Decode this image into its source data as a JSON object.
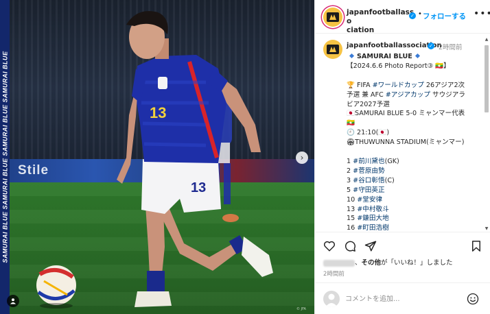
{
  "photo": {
    "side_banner_text": "SAMURAI BLUE SAMURAI BLUE SAMURAI BLUE SAMURAI BLUE",
    "ad_text": "Stile",
    "jersey_number": "13",
    "shorts_number": "13",
    "credit": "© JFA"
  },
  "header": {
    "username_line1": "japanfootballasso",
    "username_line2": "ciation",
    "follow_label": "フォローする",
    "separator": "•",
    "more_label": "•••"
  },
  "caption": {
    "username": "japanfootballassociation",
    "time": "2時間前",
    "lines": [
      {
        "type": "title",
        "text": "SAMURAI BLUE"
      },
      {
        "type": "plain",
        "text": "【2024.6.6 Photo Report③ 🇲🇲】"
      },
      {
        "type": "plain",
        "text": ""
      },
      {
        "type": "rich",
        "prefix": "🏆 FIFA ",
        "tag": "#ワールドカップ",
        "suffix": " 26アジア2次"
      },
      {
        "type": "rich",
        "prefix": "予選 兼 AFC ",
        "tag": "#アジアカップ",
        "suffix": " サウジアラ"
      },
      {
        "type": "plain",
        "text": "ビア2027予選"
      },
      {
        "type": "plain",
        "text": "🇯🇵SAMURAI BLUE 5-0 ミャンマー代表"
      },
      {
        "type": "plain",
        "text": "🇲🇲"
      },
      {
        "type": "plain",
        "text": "🕘 21:10(🇯🇵)"
      },
      {
        "type": "plain",
        "text": "🏟THUWUNNA STADIUM(ミャンマー)"
      },
      {
        "type": "plain",
        "text": ""
      },
      {
        "type": "rich",
        "prefix": "1 ",
        "tag": "#前川黛也",
        "suffix": "(GK)"
      },
      {
        "type": "rich",
        "prefix": "2 ",
        "tag": "#菅原由勢",
        "suffix": ""
      },
      {
        "type": "rich",
        "prefix": "3 ",
        "tag": "#谷口彰悟",
        "suffix": "(C)"
      },
      {
        "type": "rich",
        "prefix": "5 ",
        "tag": "#守田英正",
        "suffix": ""
      },
      {
        "type": "rich",
        "prefix": "10 ",
        "tag": "#堂安律",
        "suffix": ""
      },
      {
        "type": "rich",
        "prefix": "13 ",
        "tag": "#中村敬斗",
        "suffix": ""
      },
      {
        "type": "rich",
        "prefix": "15 ",
        "tag": "#鎌田大地",
        "suffix": ""
      },
      {
        "type": "rich",
        "prefix": "16 ",
        "tag": "#町田浩樹",
        "suffix": ""
      }
    ]
  },
  "actions": {
    "icons": [
      "heart-icon",
      "comment-icon",
      "share-icon",
      "bookmark-icon"
    ],
    "likes_middle": "、",
    "likes_other": "その他",
    "likes_suffix": "が「いいね！」しました",
    "post_time": "2時間前"
  },
  "comment": {
    "placeholder": "コメントを追加..."
  },
  "colors": {
    "link": "#0095f6",
    "hashtag": "#00376b",
    "jersey": "#1e2fa8",
    "pitch": "#2b6e28"
  }
}
